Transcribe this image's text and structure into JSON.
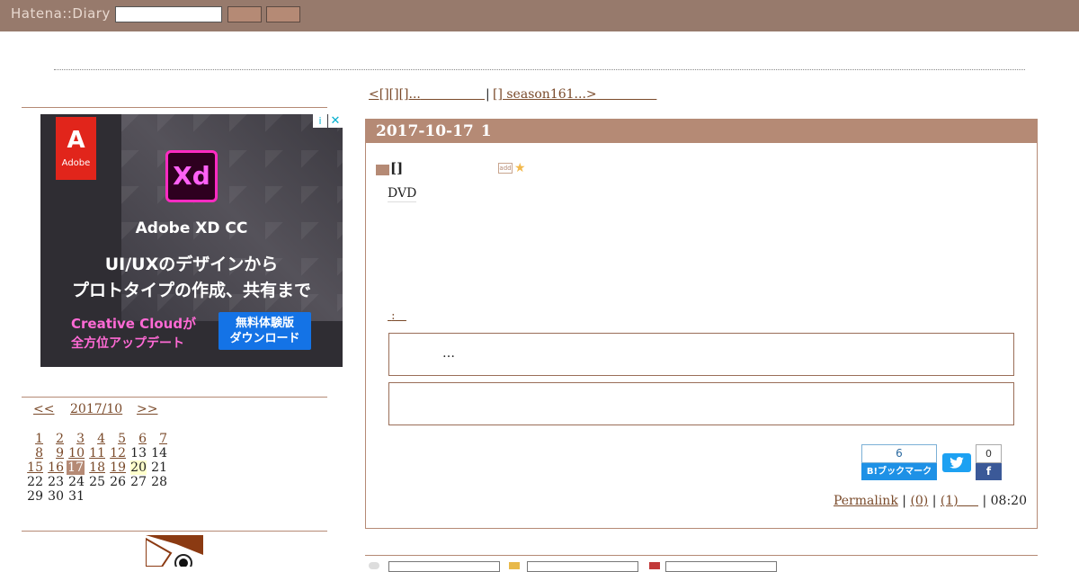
{
  "topbar": {
    "logo": "Hatena::Diary",
    "search_value": ""
  },
  "sidebar": {
    "ad": {
      "brand": "Adobe",
      "brand_mark": "A",
      "product_mark": "Xd",
      "product": "Adobe XD CC",
      "headline1": "UI/UXのデザインから",
      "headline2": "プロトタイプの作成、共有まで",
      "creative_cloud_line1": "Creative Cloudが",
      "creative_cloud_line2": "全方位アップデート",
      "cta_line1": "無料体験版",
      "cta_line2": "ダウンロード",
      "info_icon": "i",
      "close_icon": "✕"
    },
    "calendar": {
      "prev": "<<",
      "month": "2017/10",
      "next": ">>",
      "weeks": [
        [
          "1",
          "2",
          "3",
          "4",
          "5",
          "6",
          "7"
        ],
        [
          "8",
          "9",
          "10",
          "11",
          "12",
          "13",
          "14"
        ],
        [
          "15",
          "16",
          "17",
          "18",
          "19",
          "20",
          "21"
        ],
        [
          "22",
          "23",
          "24",
          "25",
          "26",
          "27",
          "28"
        ],
        [
          "29",
          "30",
          "31",
          "",
          "",
          "",
          ""
        ]
      ]
    }
  },
  "nav": {
    "prev": "<[][][]...",
    "separator": "|",
    "next": "[] season161...>"
  },
  "entry": {
    "date": "2017-10-17",
    "title": "1",
    "section_title": "[]",
    "body": "DVD",
    "comment_link": ":",
    "comment_excerpt": "…",
    "hatena_bookmark_count": "6",
    "hatena_bookmark_label": "B!ブックマーク",
    "facebook_count": "0",
    "permalink": "Permalink",
    "comments_count": "(0)",
    "trackbacks_count": "(1)",
    "time": "08:20"
  },
  "colors": {
    "topbar": "#977a6c",
    "accent": "#b58a75",
    "link": "#7a4a2a"
  }
}
